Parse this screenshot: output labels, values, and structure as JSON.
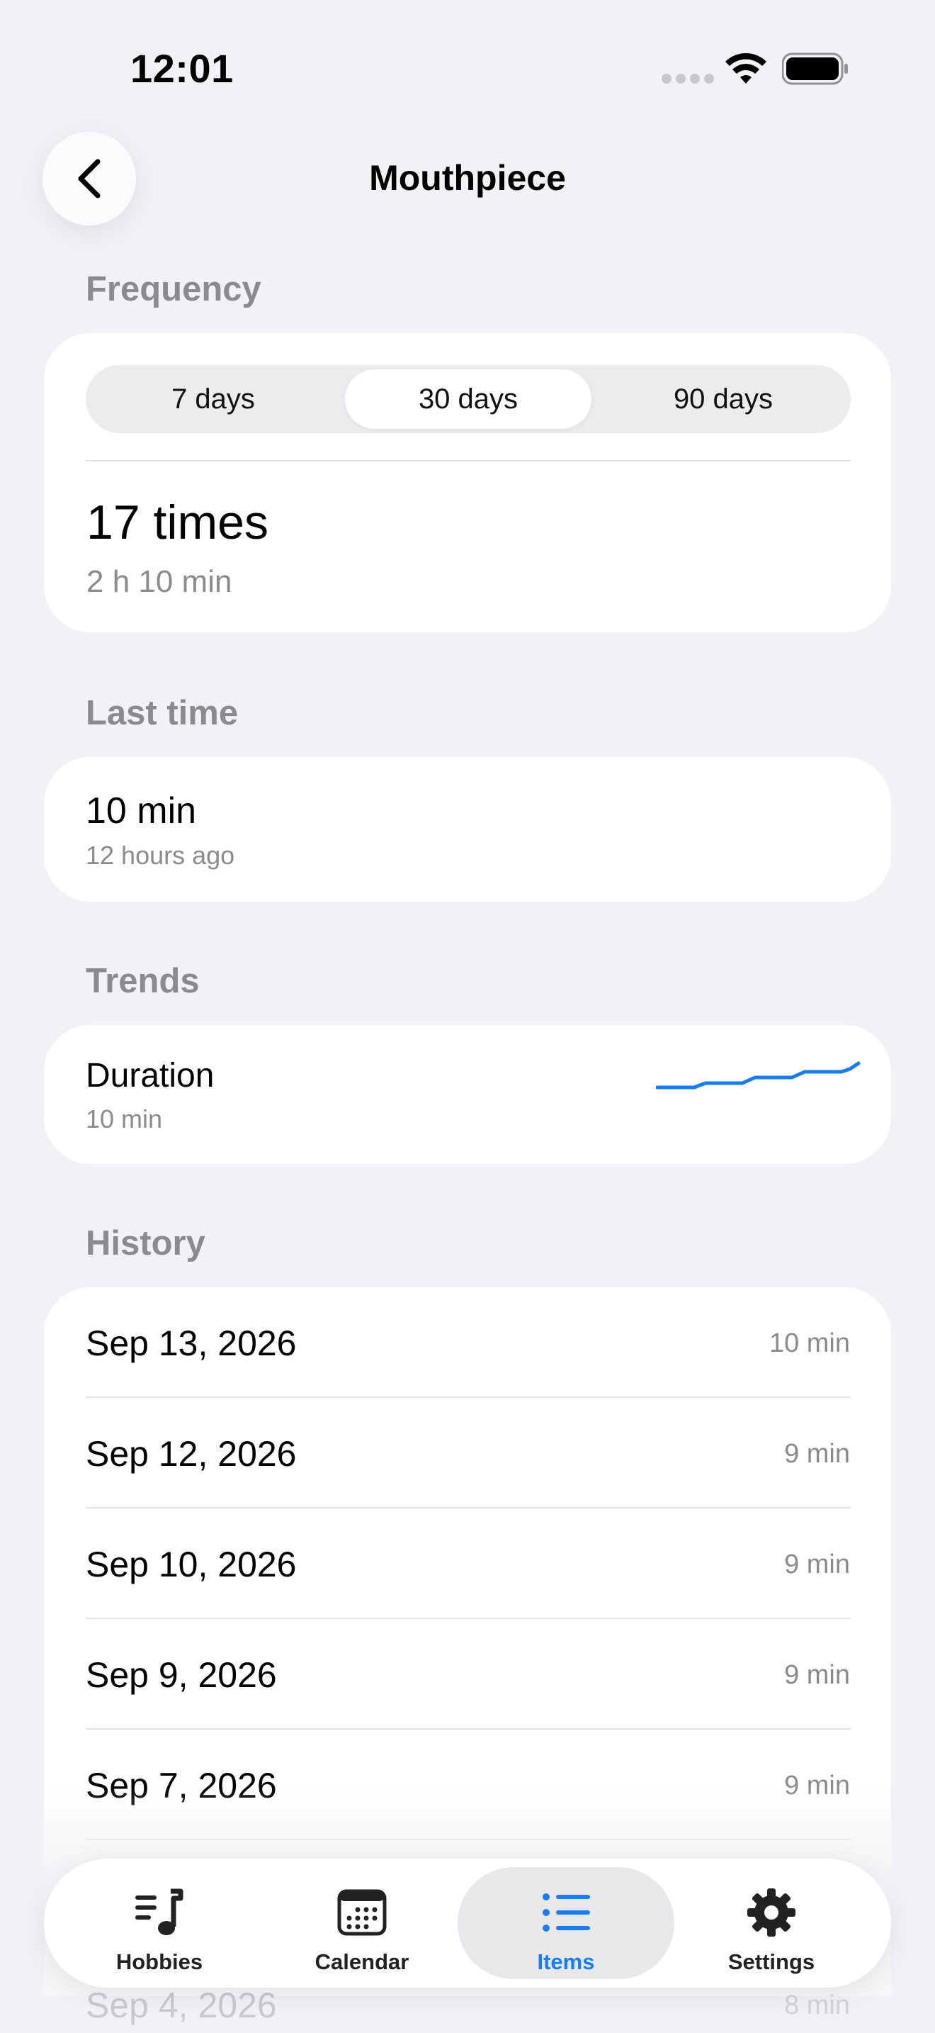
{
  "status_bar": {
    "time": "12:01"
  },
  "nav": {
    "title": "Mouthpiece"
  },
  "frequency": {
    "header": "Frequency",
    "segments": [
      "7 days",
      "30 days",
      "90 days"
    ],
    "selected_segment": "30 days",
    "count": "17 times",
    "total": "2 h 10 min"
  },
  "last_time": {
    "header": "Last time",
    "value": "10 min",
    "ago": "12 hours ago"
  },
  "trends": {
    "header": "Trends",
    "label": "Duration",
    "value": "10 min",
    "accent_color": "#1a7cf5"
  },
  "history": {
    "header": "History",
    "rows": [
      {
        "date": "Sep 13, 2026",
        "duration": "10 min"
      },
      {
        "date": "Sep 12, 2026",
        "duration": "9 min"
      },
      {
        "date": "Sep 10, 2026",
        "duration": "9 min"
      },
      {
        "date": "Sep 9, 2026",
        "duration": "9 min"
      },
      {
        "date": "Sep 7, 2026",
        "duration": "9 min"
      }
    ],
    "faded_row": {
      "date": "Sep 4, 2026",
      "duration": "8 min"
    }
  },
  "tabs": [
    {
      "label": "Hobbies",
      "icon": "music-list-icon"
    },
    {
      "label": "Calendar",
      "icon": "calendar-icon"
    },
    {
      "label": "Items",
      "icon": "list-icon",
      "active": true
    },
    {
      "label": "Settings",
      "icon": "gear-icon"
    }
  ]
}
